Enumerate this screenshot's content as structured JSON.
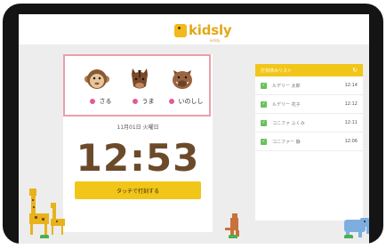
{
  "app": {
    "logo_text": "kidsly",
    "logo_sub": "kidsly"
  },
  "animals": [
    {
      "label": "さる",
      "icon": "monkey-icon"
    },
    {
      "label": "うま",
      "icon": "horse-icon"
    },
    {
      "label": "いのしし",
      "icon": "boar-icon"
    }
  ],
  "date_text": "11月01日 火曜日",
  "clock": "12:53",
  "punch_button": "タッチで打刻する",
  "attendance": {
    "title": "打刻済みリスト",
    "entries": [
      {
        "name": "ルデリー 太郎",
        "time": "12:14"
      },
      {
        "name": "ルデリー 花子",
        "time": "12:12"
      },
      {
        "name": "コニファ ふくみ",
        "time": "12:11"
      },
      {
        "name": "コニファー 静",
        "time": "12:06"
      }
    ]
  },
  "colors": {
    "accent": "#f2c618",
    "brand": "#e3a817",
    "selection": "#e8a0aa",
    "clock": "#6b4a2a",
    "check": "#6cbf5c",
    "dot": "#e35a96"
  }
}
